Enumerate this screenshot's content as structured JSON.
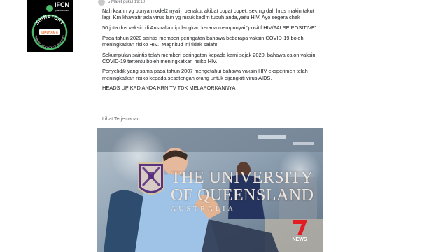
{
  "badge": {
    "brand_top": "IFCN",
    "brand_sub": "@factchecknet",
    "arc_top": "SIGNATORY",
    "arc_bottom": "VERIFIED • IFCN CODE OF PRINCIPLES",
    "partner": "LIPUTAN 6"
  },
  "post": {
    "header_text": "5 Maret pukul 19:10",
    "paragraphs": [
      "Nah kaann yg punya model2 nyali   penakut akibat copat copet, sekrng dah hrus makin takut lagi. Krn khawatir ada virus lain yg msuk kedlm tubuh anda,yaitu HIV. Ayo segera chek",
      "50 juta dos vaksin di Australia dipulangkan kerana mempunyai \"positif HIV/FALSE POSITIVE\"",
      "Pada tahun 2020 saintis memberi peringatan bahawa beberapa vaksin COVID-19 boleh meningkatkan risiko HIV.  Magnitud ini tidak salah!",
      "Sekumpulan saintis telah memberi peringatan kepada kami sejak 2020, bahawa calon vaksin COVID-19 tertentu boleh meningkatkan risiko HIV.",
      "Penyelidik yang sama pada tahun 2007 mengetahui bahawa vaksin HIV eksperimen telah meningkatkan risiko kepada sesetengah orang untuk dijangkiti virus AIDS.",
      "HEADS UP KPD ANDA KRN TV TDK MELAPORKANNYA"
    ],
    "see_translation": "Lihat Terjemahan"
  },
  "video": {
    "overlay_line1": "THE UNIVERSITY",
    "overlay_line2": "OF QUEENSLAND",
    "overlay_line3": "AUSTRALIA",
    "news_number": "7",
    "news_label": "NEWS"
  },
  "colors": {
    "text": "#1c1e21",
    "muted": "#65676b",
    "badge_bg": "#000000",
    "badge_green": "#4dbb6b",
    "news_red": "#e31b23"
  }
}
